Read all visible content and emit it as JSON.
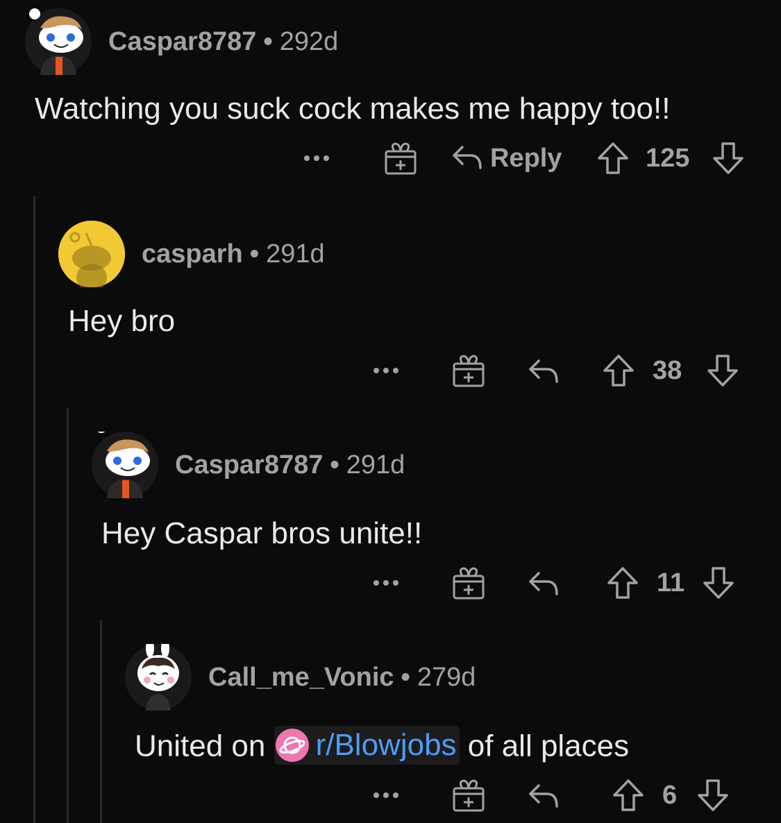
{
  "comments": [
    {
      "username": "Caspar8787",
      "age": "292d",
      "text": "Watching you suck cock makes me happy too!!",
      "reply_label": "Reply",
      "score": "125"
    },
    {
      "username": "casparh",
      "age": "291d",
      "text": "Hey bro",
      "score": "38"
    },
    {
      "username": "Caspar8787",
      "age": "291d",
      "text": "Hey Caspar bros unite!!",
      "score": "11"
    },
    {
      "username": "Call_me_Vonic",
      "age": "279d",
      "text_before": "United on ",
      "subreddit": "r/Blowjobs",
      "text_after": " of all places",
      "score": "6"
    }
  ],
  "separator": "•",
  "icons": [
    "more-icon",
    "award-icon",
    "reply-icon",
    "upvote-icon",
    "downvote-icon"
  ],
  "colors": {
    "background": "#0b0b0b",
    "meta": "#a0a3a6",
    "link": "#4f9cf5",
    "subreddit_icon": "#ef77b0",
    "avatar_yellow": "#f1c933"
  }
}
